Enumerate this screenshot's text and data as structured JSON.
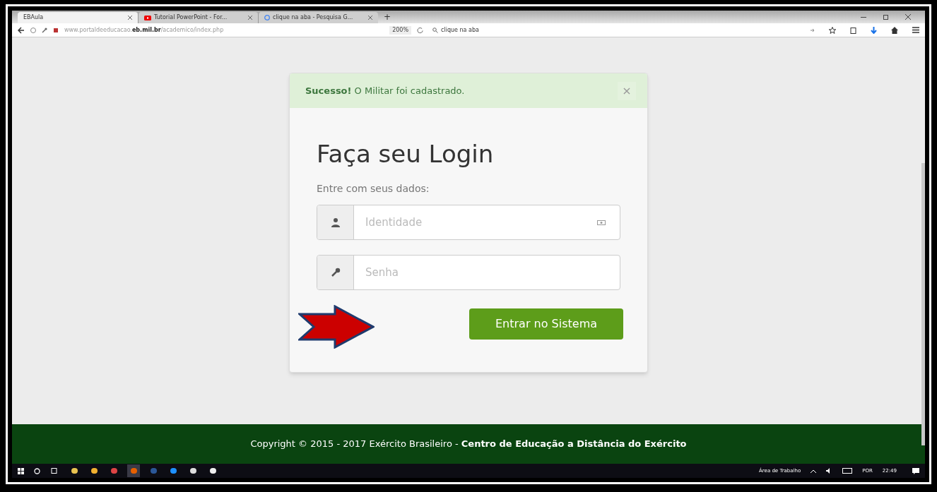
{
  "browser": {
    "tabs": [
      {
        "title": "EBAula",
        "kind": "plain",
        "selected": true
      },
      {
        "title": "Tutorial PowerPoint - For...",
        "kind": "video",
        "selected": false
      },
      {
        "title": "clique na aba - Pesquisa G...",
        "kind": "search",
        "selected": false
      }
    ],
    "new_tab": "+",
    "url": "www.portaldeeducacao.**eb.mil.br**/academico/index.php",
    "zoom": "200%",
    "search": "clique na aba"
  },
  "alert": {
    "message": "**Sucesso!** O Militar foi cadastrado.",
    "close": "×"
  },
  "login": {
    "title": "Faça seu Login",
    "subtitle": "Entre com seus dados:",
    "fields": [
      {
        "kind": "user",
        "placeholder": "Identidade"
      },
      {
        "kind": "key",
        "placeholder": "Senha"
      }
    ],
    "button": "Entrar no Sistema"
  },
  "footer": "Copyright © 2015 - 2017 Exército Brasileiro - **Centro de Educação a Distância do Exército**",
  "taskbar": {
    "apps": [
      {
        "kind": "folder",
        "active": false
      },
      {
        "kind": "media",
        "active": false
      },
      {
        "kind": "chrome",
        "active": false
      },
      {
        "kind": "firefox",
        "active": true
      },
      {
        "kind": "word",
        "active": false
      },
      {
        "kind": "edge",
        "active": false
      },
      {
        "kind": "store",
        "active": false
      },
      {
        "kind": "paint",
        "active": false
      }
    ],
    "desktop": "Área de Trabalho",
    "language": "POR",
    "time": "22:49"
  }
}
